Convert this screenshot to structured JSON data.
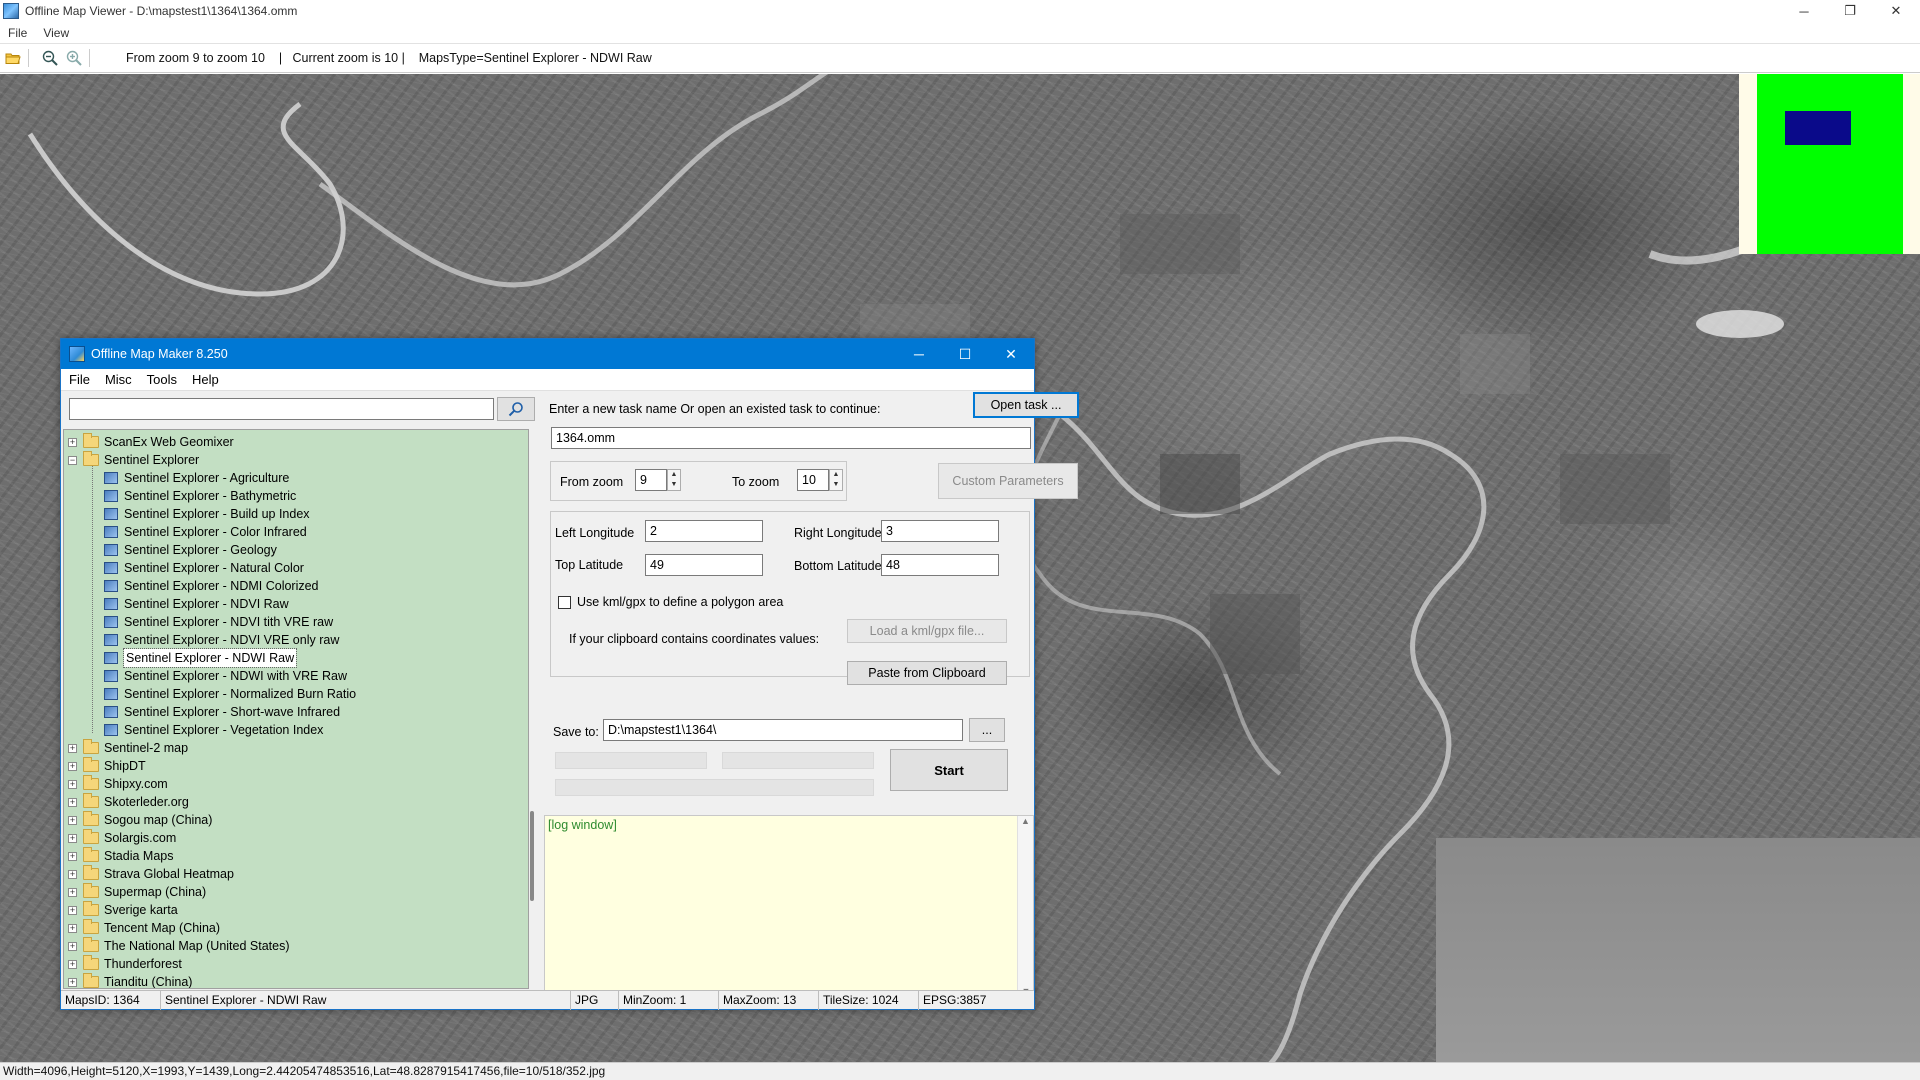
{
  "viewer": {
    "title": "Offline Map Viewer - D:\\mapstest1\\1364\\1364.omm",
    "menu": [
      "File",
      "View"
    ],
    "window_controls": {
      "minimize": "─",
      "restore": "❐",
      "close": "✕"
    },
    "toolbar": {
      "status_text": "From zoom 9 to zoom 10    |   Current zoom is 10 |    MapsType=Sentinel Explorer - NDWI Raw"
    },
    "statusbar": "Width=4096,Height=5120,X=1993,Y=1439,Long=2.44205474853516,Lat=48.8287915417456,file=10/518/352.jpg"
  },
  "dialog": {
    "title": "Offline Map Maker 8.250",
    "window_controls": {
      "minimize": "─",
      "maximize": "☐",
      "close": "✕"
    },
    "menu": [
      "File",
      "Misc",
      "Tools",
      "Help"
    ],
    "search": {
      "value": "",
      "placeholder": ""
    },
    "tree": [
      {
        "label": "ScanEx Web Geomixer",
        "level": 0,
        "type": "folder",
        "expander": "+"
      },
      {
        "label": "Sentinel Explorer",
        "level": 0,
        "type": "folder-open",
        "expander": "−"
      },
      {
        "label": "Sentinel Explorer - Agriculture",
        "level": 1,
        "type": "map"
      },
      {
        "label": "Sentinel Explorer - Bathymetric",
        "level": 1,
        "type": "map"
      },
      {
        "label": "Sentinel Explorer - Build up Index",
        "level": 1,
        "type": "map"
      },
      {
        "label": "Sentinel Explorer - Color Infrared",
        "level": 1,
        "type": "map"
      },
      {
        "label": "Sentinel Explorer - Geology",
        "level": 1,
        "type": "map"
      },
      {
        "label": "Sentinel Explorer - Natural Color",
        "level": 1,
        "type": "map"
      },
      {
        "label": "Sentinel Explorer - NDMI Colorized",
        "level": 1,
        "type": "map"
      },
      {
        "label": "Sentinel Explorer - NDVI Raw",
        "level": 1,
        "type": "map"
      },
      {
        "label": "Sentinel Explorer - NDVI tith VRE raw",
        "level": 1,
        "type": "map"
      },
      {
        "label": "Sentinel Explorer - NDVI VRE only raw",
        "level": 1,
        "type": "map"
      },
      {
        "label": "Sentinel Explorer - NDWI Raw",
        "level": 1,
        "type": "map",
        "selected": true
      },
      {
        "label": "Sentinel Explorer - NDWI with VRE Raw",
        "level": 1,
        "type": "map"
      },
      {
        "label": "Sentinel Explorer - Normalized Burn Ratio",
        "level": 1,
        "type": "map"
      },
      {
        "label": "Sentinel Explorer - Short-wave Infrared",
        "level": 1,
        "type": "map"
      },
      {
        "label": "Sentinel Explorer - Vegetation Index",
        "level": 1,
        "type": "map"
      },
      {
        "label": "Sentinel-2 map",
        "level": 0,
        "type": "folder",
        "expander": "+"
      },
      {
        "label": "ShipDT",
        "level": 0,
        "type": "folder",
        "expander": "+"
      },
      {
        "label": "Shipxy.com",
        "level": 0,
        "type": "folder",
        "expander": "+"
      },
      {
        "label": "Skoterleder.org",
        "level": 0,
        "type": "folder",
        "expander": "+"
      },
      {
        "label": "Sogou map (China)",
        "level": 0,
        "type": "folder",
        "expander": "+"
      },
      {
        "label": "Solargis.com",
        "level": 0,
        "type": "folder",
        "expander": "+"
      },
      {
        "label": "Stadia Maps",
        "level": 0,
        "type": "folder",
        "expander": "+"
      },
      {
        "label": "Strava Global Heatmap",
        "level": 0,
        "type": "folder",
        "expander": "+"
      },
      {
        "label": "Supermap (China)",
        "level": 0,
        "type": "folder",
        "expander": "+"
      },
      {
        "label": "Sverige karta",
        "level": 0,
        "type": "folder",
        "expander": "+"
      },
      {
        "label": "Tencent Map (China)",
        "level": 0,
        "type": "folder",
        "expander": "+"
      },
      {
        "label": "The National Map (United States)",
        "level": 0,
        "type": "folder",
        "expander": "+"
      },
      {
        "label": "Thunderforest",
        "level": 0,
        "type": "folder",
        "expander": "+"
      },
      {
        "label": "Tianditu (China)",
        "level": 0,
        "type": "folder",
        "expander": "+"
      }
    ],
    "task": {
      "prompt": "Enter a new task name Or open an existed task to continue:",
      "open_button": "Open task ...",
      "name_value": "1364.omm"
    },
    "zoom": {
      "from_label": "From zoom",
      "from_value": "9",
      "to_label": "To zoom",
      "to_value": "10",
      "custom_button": "Custom Parameters"
    },
    "coords": {
      "left_lon_label": "Left Longitude",
      "left_lon_value": "2",
      "right_lon_label": "Right Longitude",
      "right_lon_value": "3",
      "top_lat_label": "Top Latitude",
      "top_lat_value": "49",
      "bottom_lat_label": "Bottom Latitude",
      "bottom_lat_value": "48",
      "kml_checkbox_label": "Use kml/gpx to define a polygon area",
      "kml_checked": false,
      "kml_button": "Load a kml/gpx file...",
      "clipboard_label": "If your clipboard contains coordinates values:",
      "clipboard_button": "Paste from Clipboard"
    },
    "save": {
      "label": "Save to:",
      "value": "D:\\mapstest1\\1364\\",
      "browse_button": "...",
      "start_button": "Start"
    },
    "log": {
      "text": "[log window]"
    },
    "status": {
      "maps_id": "MapsID: 1364",
      "maps_name": "Sentinel Explorer - NDWI Raw",
      "format": "JPG",
      "min_zoom": "MinZoom: 1",
      "max_zoom": "MaxZoom: 13",
      "tile_size": "TileSize: 1024",
      "epsg": "EPSG:3857"
    }
  },
  "colors": {
    "dialog_titlebar": "#0078d4",
    "tree_background": "#c3dfc3",
    "log_background": "#ffffe0",
    "log_text": "#2e8b2e",
    "overview_green": "#00ff00",
    "overview_blue": "#0a0a8a"
  },
  "icons": [
    "app-icon",
    "open-folder-icon",
    "zoom-out-icon",
    "zoom-in-icon",
    "search-icon",
    "folder-icon",
    "map-layer-icon"
  ]
}
